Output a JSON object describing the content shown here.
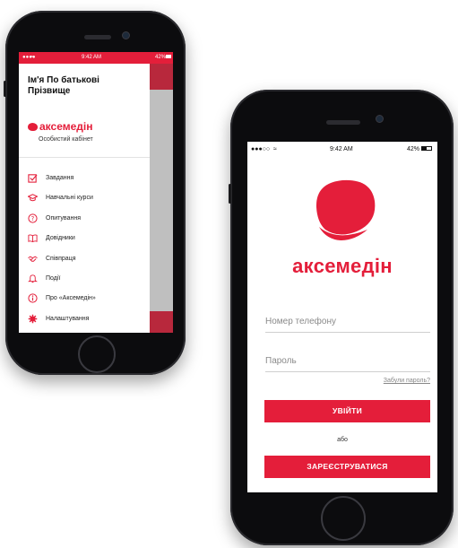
{
  "screen1": {
    "status": {
      "carrier": "●●●● ",
      "time": "9:42 AM",
      "battery": "42%"
    },
    "user_name": "Ім'я По батькові Прізвище",
    "brand": "аксемедін",
    "cabinet": "Особистий кабінет",
    "menu": [
      {
        "label": "Завдання",
        "icon": "task-icon"
      },
      {
        "label": "Навчальні курси",
        "icon": "graduation-cap-icon"
      },
      {
        "label": "Опитування",
        "icon": "question-icon"
      },
      {
        "label": "Довідники",
        "icon": "book-icon"
      },
      {
        "label": "Співпраця",
        "icon": "handshake-icon"
      },
      {
        "label": "Події",
        "icon": "bell-icon"
      },
      {
        "label": "Про «Аксемедін»",
        "icon": "info-icon"
      },
      {
        "label": "Налаштування",
        "icon": "gear-icon"
      }
    ]
  },
  "screen2": {
    "status": {
      "carrier": "●●●○○",
      "time": "9:42 AM",
      "battery": "42%"
    },
    "brand": "аксемедін",
    "phone_placeholder": "Номер телефону",
    "password_placeholder": "Пароль",
    "forgot": "Забули пароль?",
    "login": "УВІЙТИ",
    "or": "або",
    "register": "ЗАРЕЄСТРУВАТИСЯ"
  },
  "colors": {
    "accent": "#e41e3a",
    "phone_body": "#0c0c0e"
  }
}
